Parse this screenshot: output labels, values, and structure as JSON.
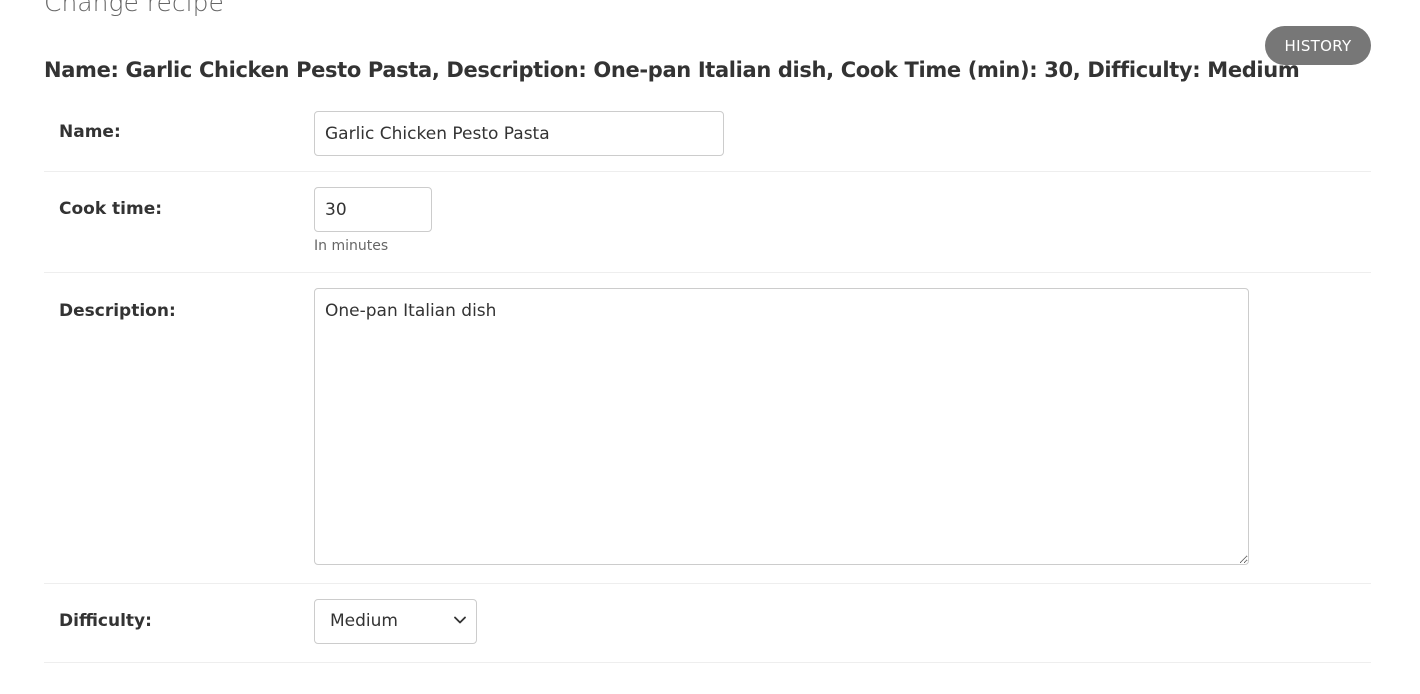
{
  "page": {
    "title": "Change recipe"
  },
  "toolbar": {
    "history_label": "HISTORY"
  },
  "object": {
    "heading": "Name: Garlic Chicken Pesto Pasta, Description: One-pan Italian dish, Cook Time (min): 30, Difficulty: Medium"
  },
  "form": {
    "name": {
      "label": "Name:",
      "value": "Garlic Chicken Pesto Pasta"
    },
    "cook_time": {
      "label": "Cook time:",
      "value": "30",
      "help": "In minutes"
    },
    "description": {
      "label": "Description:",
      "value": "One-pan Italian dish"
    },
    "difficulty": {
      "label": "Difficulty:",
      "value": "Medium"
    }
  },
  "icons": {
    "select_arrow": "chevron-down-icon",
    "textarea_resize": "resize-handle-icon"
  },
  "colors": {
    "history_button_bg": "#777777",
    "history_button_text": "#ffffff",
    "text": "#333333",
    "border": "#cccccc",
    "divider": "#eeeeee"
  }
}
